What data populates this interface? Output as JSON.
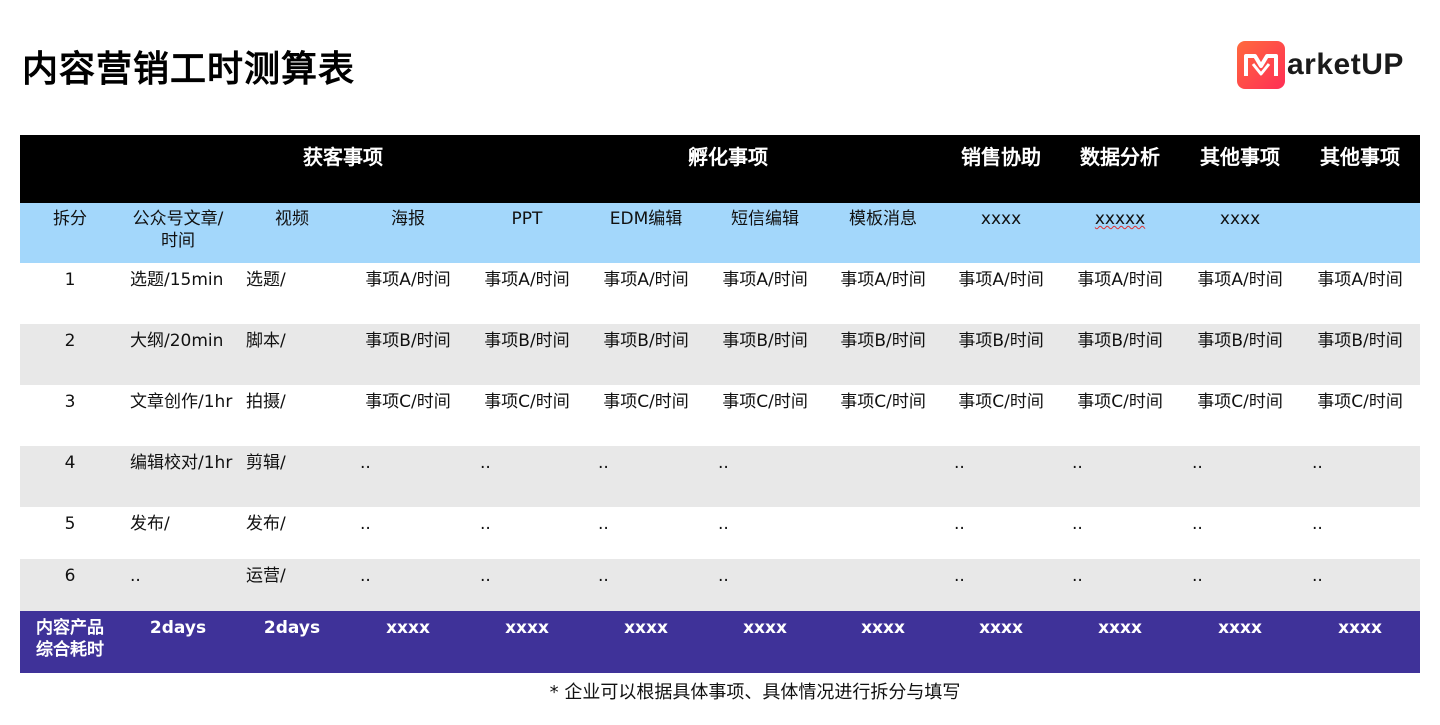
{
  "title": "内容营销工时测算表",
  "logo": {
    "text": "arketUP",
    "mark_color": "#ff4040"
  },
  "header_band": {
    "groups": [
      "获客事项",
      "孵化事项",
      "销售协助",
      "数据分析",
      "其他事项",
      "其他事项"
    ]
  },
  "sub_header": [
    "拆分",
    "公众号文章/时间",
    "视频",
    "海报",
    "PPT",
    "EDM编辑",
    "短信编辑",
    "模板消息",
    "xxxx",
    "xxxxx",
    "xxxx",
    ""
  ],
  "rows": [
    {
      "n": "1",
      "article": "选题/15min",
      "video": "选题/",
      "cells": [
        "事项A/时间",
        "事项A/时间",
        "事项A/时间",
        "事项A/时间",
        "事项A/时间",
        "事项A/时间",
        "事项A/时间",
        "事项A/时间",
        "事项A/时间"
      ]
    },
    {
      "n": "2",
      "article": "大纲/20min",
      "video": "脚本/",
      "cells": [
        "事项B/时间",
        "事项B/时间",
        "事项B/时间",
        "事项B/时间",
        "事项B/时间",
        "事项B/时间",
        "事项B/时间",
        "事项B/时间",
        "事项B/时间"
      ]
    },
    {
      "n": "3",
      "article": "文章创作/1hr",
      "video": "拍摄/",
      "cells": [
        "事项C/时间",
        "事项C/时间",
        "事项C/时间",
        "事项C/时间",
        "事项C/时间",
        "事项C/时间",
        "事项C/时间",
        "事项C/时间",
        "事项C/时间"
      ]
    },
    {
      "n": "4",
      "article": "编辑校对/1hr",
      "video": "剪辑/",
      "cells": [
        "..",
        "..",
        "..",
        "..",
        "",
        "..",
        "..",
        "..",
        ".."
      ]
    },
    {
      "n": "5",
      "article": "发布/",
      "video": "发布/",
      "cells": [
        "..",
        "..",
        "..",
        "..",
        "",
        "..",
        "..",
        "..",
        ".."
      ]
    },
    {
      "n": "6",
      "article": "..",
      "video": "运营/",
      "cells": [
        "..",
        "..",
        "..",
        "..",
        "",
        "..",
        "..",
        "..",
        ".."
      ]
    }
  ],
  "total_row": {
    "label": "内容产品综合耗时",
    "values": [
      "2days",
      "2days",
      "xxxx",
      "xxxx",
      "xxxx",
      "xxxx",
      "xxxx",
      "xxxx",
      "xxxx",
      "xxxx",
      "xxxx"
    ]
  },
  "footnote": "* 企业可以根据具体事项、具体情况进行拆分与填写"
}
